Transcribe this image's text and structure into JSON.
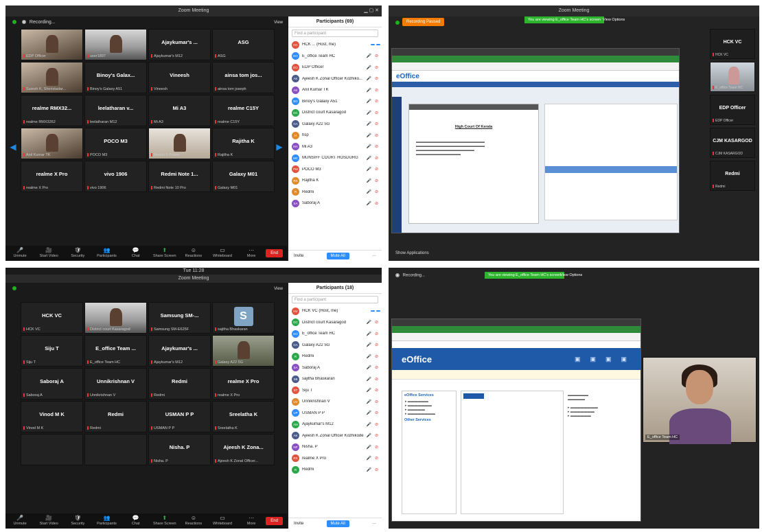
{
  "panel1": {
    "title": "Zoom Meeting",
    "recording": "Recording...",
    "view": "View",
    "tiles": [
      {
        "name": "",
        "label": "EDP Officer",
        "video": true
      },
      {
        "name": "",
        "label": "user1897",
        "video": true
      },
      {
        "name": "Ajaykumar's ...",
        "label": "Ajaykumar's M12",
        "video": false
      },
      {
        "name": "ASG",
        "label": "ASG",
        "video": false
      },
      {
        "name": "",
        "label": "Suresh K, Sheristadar...",
        "video": true
      },
      {
        "name": "Binoy's Galax...",
        "label": "Binoy's Galaxy A51",
        "video": false
      },
      {
        "name": "Vineesh",
        "label": "Vineesh",
        "video": false
      },
      {
        "name": "ainsa tom jos...",
        "label": "ainsa tom joseph",
        "video": false
      },
      {
        "name": "realme RMX32...",
        "label": "realme RMX3262",
        "video": false
      },
      {
        "name": "leelatharan v...",
        "label": "leelatharan M12",
        "video": false
      },
      {
        "name": "Mi A3",
        "label": "Mi A3",
        "video": false
      },
      {
        "name": "realme C15Y",
        "label": "realme C15Y",
        "video": false
      },
      {
        "name": "",
        "label": "Anil Kumar TK",
        "video": true
      },
      {
        "name": "POCO M3",
        "label": "POCO M3",
        "video": false
      },
      {
        "name": "",
        "label": "Redmi 5 Power",
        "video": true
      },
      {
        "name": "Rajitha K",
        "label": "Rajitha K",
        "video": false
      },
      {
        "name": "realme X Pro",
        "label": "realme X Pro",
        "video": false
      },
      {
        "name": "vivo 1906",
        "label": "vivo 1906",
        "video": false
      },
      {
        "name": "Redmi Note 1...",
        "label": "Redmi Note 10 Pro",
        "video": false
      },
      {
        "name": "Galaxy M01",
        "label": "Galaxy M01",
        "video": false
      }
    ],
    "toolbar": [
      "Unmute",
      "Start Video",
      "Security",
      "Participants",
      "Chat",
      "Share Screen",
      "Reactions",
      "Whiteboard",
      "More"
    ],
    "end": "End",
    "participants": {
      "header": "Participants (69)",
      "search": "Find a participant",
      "rows": [
        {
          "init": "HC",
          "name": "HCK ...  (Host, me)",
          "color": "#e0533d"
        },
        {
          "init": "EO",
          "name": "E_office Team HC",
          "color": "#2d8cff"
        },
        {
          "init": "EO",
          "name": "EDP Officer",
          "color": "#e0533d"
        },
        {
          "init": "AK",
          "name": "Ajeesh K Zonal Officer Kozhiko...",
          "color": "#4a5a8a"
        },
        {
          "init": "AK",
          "name": "Anil Kumar TK",
          "color": "#8a4fc2"
        },
        {
          "init": "BG",
          "name": "Binoy's Galaxy A51",
          "color": "#2d8cff"
        },
        {
          "init": "DC",
          "name": "District court Kasaragod",
          "color": "#2aa84a"
        },
        {
          "init": "GA",
          "name": "Galaxy A22 5G",
          "color": "#4a5a8a"
        },
        {
          "init": "H",
          "name": "hsp",
          "color": "#e08a2b"
        },
        {
          "init": "MA",
          "name": "Mi A3",
          "color": "#8a4fc2"
        },
        {
          "init": "MC",
          "name": "MUNSIFF COURT HOSDURG",
          "color": "#2d8cff"
        },
        {
          "init": "PM",
          "name": "POCO M3",
          "color": "#e0533d"
        },
        {
          "init": "RK",
          "name": "Rajitha K",
          "color": "#e08a2b"
        },
        {
          "init": "R",
          "name": "Redmi",
          "color": "#e08a2b"
        },
        {
          "init": "SA",
          "name": "Saboraj A",
          "color": "#8a4fc2"
        }
      ],
      "invite": "Invite",
      "mute_all": "Mute All"
    }
  },
  "panel2": {
    "title": "Zoom Meeting",
    "recording_chip": "Recording Paused",
    "share_label": "You are viewing E_office Team HC's screen",
    "view_options": "View Options",
    "eoffice_brand": "eOffice",
    "doc_heading": "High Court Of Kerala",
    "side_tiles": [
      {
        "name": "HCK VC",
        "label": "HCK VC",
        "video": false
      },
      {
        "name": "",
        "label": "E_office Team HC",
        "video": true
      },
      {
        "name": "EDP Officer",
        "label": "EDP Officer",
        "video": false
      },
      {
        "name": "CJM KASARGOD",
        "label": "CJM KASARGOD",
        "video": false
      },
      {
        "name": "Redmi",
        "label": "Redmi",
        "video": false
      }
    ],
    "show_apps": "Show Applications"
  },
  "panel3": {
    "title": "Zoom Meeting",
    "clock": "Tue 11:28",
    "view": "View",
    "tiles": [
      {
        "name": "HCK VC",
        "label": "HCK VC",
        "video": false
      },
      {
        "name": "",
        "label": "District court Kasaragod",
        "video": true
      },
      {
        "name": "Samsung SM-...",
        "label": "Samsung SM-E625F",
        "video": false
      },
      {
        "name": "S",
        "label": "sajitha Bhaskaran",
        "video": false,
        "avatar": true
      },
      {
        "name": "Siju T",
        "label": "Siju T",
        "video": false
      },
      {
        "name": "E_office Team ...",
        "label": "E_office Team HC",
        "video": false
      },
      {
        "name": "Ajaykumar's ...",
        "label": "Ajaykumar's M12",
        "video": false
      },
      {
        "name": "",
        "label": "Galaxy A22 5G",
        "video": true
      },
      {
        "name": "Saboraj A",
        "label": "Saboraj A",
        "video": false
      },
      {
        "name": "Unnikrishnan V",
        "label": "Unnikrishnan V",
        "video": false
      },
      {
        "name": "Redmi",
        "label": "Redmi",
        "video": false
      },
      {
        "name": "realme X Pro",
        "label": "realme X Pro",
        "video": false
      },
      {
        "name": "Vinod M K",
        "label": "Vinod M K",
        "video": false
      },
      {
        "name": "Redmi",
        "label": "Redmi",
        "video": false
      },
      {
        "name": "USMAN P P",
        "label": "USMAN P P",
        "video": false
      },
      {
        "name": "Sreelatha K",
        "label": "Sreelatha K",
        "video": false
      },
      {
        "name": "",
        "label": "",
        "video": false
      },
      {
        "name": "",
        "label": "",
        "video": false
      },
      {
        "name": "Nisha. P",
        "label": "Nisha. P",
        "video": false
      },
      {
        "name": "Ajeesh K Zona...",
        "label": "Ajeesh K Zonal Officer...",
        "video": false
      }
    ],
    "toolbar": [
      "Unmute",
      "Start Video",
      "Security",
      "Participants",
      "Chat",
      "Share Screen",
      "Reactions",
      "Whiteboard",
      "More"
    ],
    "end": "End",
    "participants": {
      "header": "Participants (18)",
      "search": "Find a participant",
      "rows": [
        {
          "init": "HV",
          "name": "HCK VC  (Host, me)",
          "color": "#e0533d"
        },
        {
          "init": "DC",
          "name": "District court Kasaragod",
          "color": "#2aa84a"
        },
        {
          "init": "EO",
          "name": "E_office Team HC",
          "color": "#2d8cff"
        },
        {
          "init": "GA",
          "name": "Galaxy A22 5G",
          "color": "#4a5a8a"
        },
        {
          "init": "R",
          "name": "Redmi",
          "color": "#2aa84a"
        },
        {
          "init": "SA",
          "name": "Saboraj A",
          "color": "#8a4fc2"
        },
        {
          "init": "SB",
          "name": "sajitha Bhaskaran",
          "color": "#4a5a8a"
        },
        {
          "init": "ST",
          "name": "Siju T",
          "color": "#e0533d"
        },
        {
          "init": "UV",
          "name": "Unnikrishnan V",
          "color": "#e08a2b"
        },
        {
          "init": "UP",
          "name": "USMAN P P",
          "color": "#2d8cff"
        },
        {
          "init": "AM",
          "name": "Ajaykumar's M12",
          "color": "#2aa84a"
        },
        {
          "init": "AK",
          "name": "Ajeesh K Zonal Officer Kozhikode",
          "color": "#4a5a8a"
        },
        {
          "init": "NP",
          "name": "Nisha. P",
          "color": "#8a4fc2"
        },
        {
          "init": "RX",
          "name": "realme X Pro",
          "color": "#e0533d"
        },
        {
          "init": "R",
          "name": "Redmi",
          "color": "#2aa84a"
        }
      ],
      "invite": "Invite",
      "mute_all": "Mute All"
    }
  },
  "panel4": {
    "recording": "Recording...",
    "share_label": "You are viewing E_office Team HC's screen",
    "view_options": "View Options",
    "eoffice_brand": "eOffice",
    "side_heading": "eOffice Services",
    "other_heading": "Other Services",
    "speaker_label": "E_office Team HC"
  }
}
